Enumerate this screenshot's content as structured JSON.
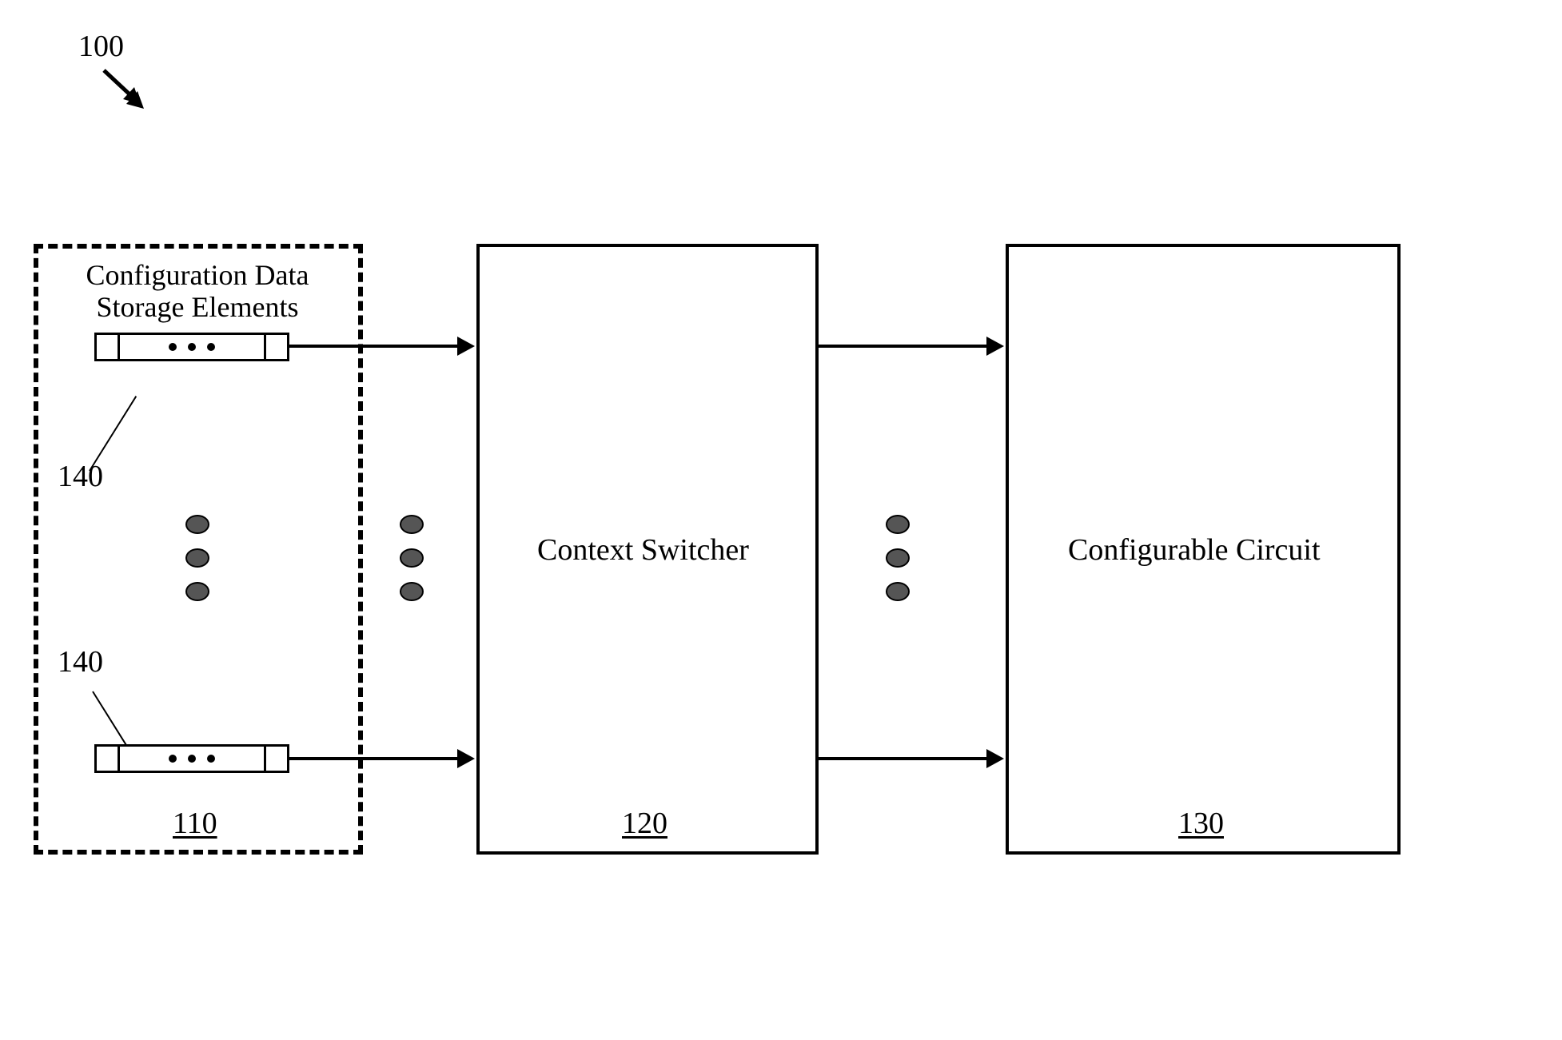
{
  "figure": {
    "ref_figure": "100",
    "blocks": {
      "storage_group": {
        "title": "Configuration Data\nStorage Elements",
        "ref": "110"
      },
      "context_switcher": {
        "title": "Context Switcher",
        "ref": "120"
      },
      "configurable_circuit": {
        "title": "Configurable Circuit",
        "ref": "130"
      }
    },
    "storage_element_ref_top": "140",
    "storage_element_ref_bottom": "140"
  }
}
